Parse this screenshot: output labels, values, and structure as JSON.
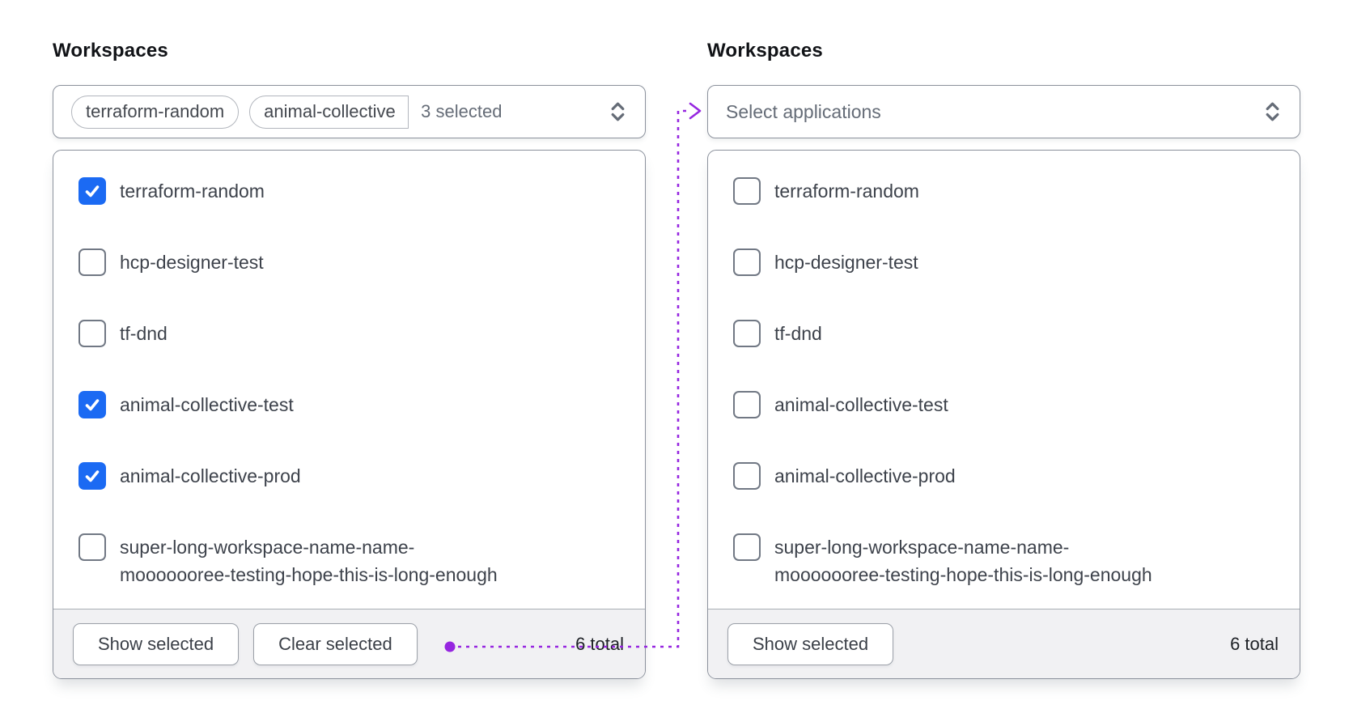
{
  "colors": {
    "checkbox_checked": "#1b6af3",
    "connector": "#9626e0"
  },
  "left_panel": {
    "label": "Workspaces",
    "trigger": {
      "tags": [
        "terraform-random",
        "animal-collective"
      ],
      "count_text": "3 selected"
    },
    "options": [
      {
        "label": "terraform-random",
        "checked": true
      },
      {
        "label": "hcp-designer-test",
        "checked": false
      },
      {
        "label": "tf-dnd",
        "checked": false
      },
      {
        "label": "animal-collective-test",
        "checked": true
      },
      {
        "label": "animal-collective-prod",
        "checked": true
      },
      {
        "label": "super-long-workspace-name-name-\nmooooooree-testing-hope-this-is-long-enough",
        "checked": false
      }
    ],
    "footer": {
      "show_selected_label": "Show selected",
      "clear_selected_label": "Clear selected",
      "total_text": "6 total"
    }
  },
  "right_panel": {
    "label": "Workspaces",
    "trigger": {
      "placeholder": "Select applications"
    },
    "options": [
      {
        "label": "terraform-random",
        "checked": false
      },
      {
        "label": "hcp-designer-test",
        "checked": false
      },
      {
        "label": "tf-dnd",
        "checked": false
      },
      {
        "label": "animal-collective-test",
        "checked": false
      },
      {
        "label": "animal-collective-prod",
        "checked": false
      },
      {
        "label": "super-long-workspace-name-name-\nmooooooree-testing-hope-this-is-long-enough",
        "checked": false
      }
    ],
    "footer": {
      "show_selected_label": "Show selected",
      "total_text": "6 total"
    }
  }
}
